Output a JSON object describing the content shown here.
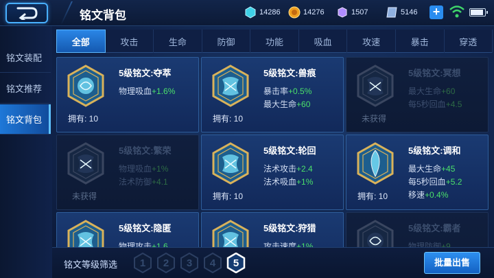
{
  "header": {
    "title": "铭文背包",
    "currencies": [
      {
        "name": "diamond-icon",
        "value": "14286",
        "color": "#3fd0e6"
      },
      {
        "name": "gold-coin-icon",
        "value": "14276",
        "color": "#f0a020"
      },
      {
        "name": "gem-icon",
        "value": "1507",
        "color": "#b08cff"
      },
      {
        "name": "voucher-icon",
        "value": "5146",
        "color": "#8fb0e0"
      }
    ]
  },
  "sidebar": {
    "items": [
      {
        "label": "铭文装配"
      },
      {
        "label": "铭文推荐"
      },
      {
        "label": "铭文背包"
      }
    ],
    "active_index": 2
  },
  "tabs": [
    "全部",
    "攻击",
    "生命",
    "防御",
    "功能",
    "吸血",
    "攻速",
    "暴击",
    "穿透"
  ],
  "active_tab": 0,
  "cards": [
    {
      "name": "5级铭文:夺萃",
      "stats": [
        {
          "label": "物理吸血",
          "value": "+1.6%"
        }
      ],
      "owned": "拥有: 10",
      "locked": false
    },
    {
      "name": "5级铭文:兽痕",
      "stats": [
        {
          "label": "暴击率",
          "value": "+0.5%"
        },
        {
          "label": "最大生命",
          "value": "+60"
        }
      ],
      "owned": "拥有: 10",
      "locked": false
    },
    {
      "name": "5级铭文:冥想",
      "stats": [
        {
          "label": "最大生命",
          "value": "+60"
        },
        {
          "label": "每5秒回血",
          "value": "+4.5"
        }
      ],
      "owned": "未获得",
      "locked": true
    },
    {
      "name": "5级铭文:繁荣",
      "stats": [
        {
          "label": "物理吸血",
          "value": "+1%"
        },
        {
          "label": "法术防御",
          "value": "+4.1"
        }
      ],
      "owned": "未获得",
      "locked": true
    },
    {
      "name": "5级铭文:轮回",
      "stats": [
        {
          "label": "法术攻击",
          "value": "+2.4"
        },
        {
          "label": "法术吸血",
          "value": "+1%"
        }
      ],
      "owned": "拥有: 10",
      "locked": false
    },
    {
      "name": "5级铭文:调和",
      "stats": [
        {
          "label": "最大生命",
          "value": "+45"
        },
        {
          "label": "每5秒回血",
          "value": "+5.2"
        },
        {
          "label": "移速",
          "value": "+0.4%"
        }
      ],
      "owned": "拥有: 10",
      "locked": false
    },
    {
      "name": "5级铭文:隐匿",
      "stats": [
        {
          "label": "物理攻击",
          "value": "+1.6"
        }
      ],
      "owned": "",
      "locked": false
    },
    {
      "name": "5级铭文:狩猎",
      "stats": [
        {
          "label": "攻击速度",
          "value": "+1%"
        }
      ],
      "owned": "",
      "locked": false
    },
    {
      "name": "5级铭文:霸者",
      "stats": [
        {
          "label": "物理防御",
          "value": "+9"
        }
      ],
      "owned": "",
      "locked": true
    }
  ],
  "bottom": {
    "filter_label": "铭文等级筛选",
    "levels": [
      "1",
      "2",
      "3",
      "4",
      "5"
    ],
    "active_level": 4,
    "sell_label": "批量出售"
  }
}
